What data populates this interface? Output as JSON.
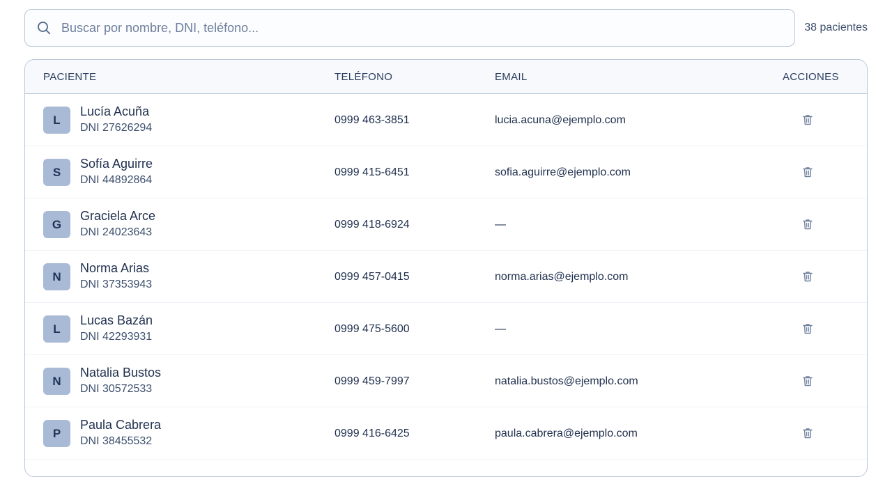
{
  "search": {
    "placeholder": "Buscar por nombre, DNI, teléfono...",
    "icon": "search-icon"
  },
  "count_label": "38 pacientes",
  "table": {
    "headers": {
      "patient": "PACIENTE",
      "phone": "TELÉFONO",
      "email": "EMAIL",
      "actions": "ACCIONES"
    },
    "rows": [
      {
        "initial": "L",
        "name": "Lucía Acuña",
        "dni": "DNI 27626294",
        "phone": "0999 463-3851",
        "email": "lucia.acuna@ejemplo.com"
      },
      {
        "initial": "S",
        "name": "Sofía Aguirre",
        "dni": "DNI 44892864",
        "phone": "0999 415-6451",
        "email": "sofia.aguirre@ejemplo.com"
      },
      {
        "initial": "G",
        "name": "Graciela Arce",
        "dni": "DNI 24023643",
        "phone": "0999 418-6924",
        "email": "—"
      },
      {
        "initial": "N",
        "name": "Norma Arias",
        "dni": "DNI 37353943",
        "phone": "0999 457-0415",
        "email": "norma.arias@ejemplo.com"
      },
      {
        "initial": "L",
        "name": "Lucas Bazán",
        "dni": "DNI 42293931",
        "phone": "0999 475-5600",
        "email": "—"
      },
      {
        "initial": "N",
        "name": "Natalia Bustos",
        "dni": "DNI 30572533",
        "phone": "0999 459-7997",
        "email": "natalia.bustos@ejemplo.com"
      },
      {
        "initial": "P",
        "name": "Paula Cabrera",
        "dni": "DNI 38455532",
        "phone": "0999 416-6425",
        "email": "paula.cabrera@ejemplo.com"
      }
    ],
    "action_icon": "trash-icon"
  },
  "colors": {
    "border": "#b9c6da",
    "avatar_bg": "#a9bad6",
    "text": "#1f2f4d",
    "muted": "#3d4f6d",
    "icon": "#6d7f9d"
  }
}
